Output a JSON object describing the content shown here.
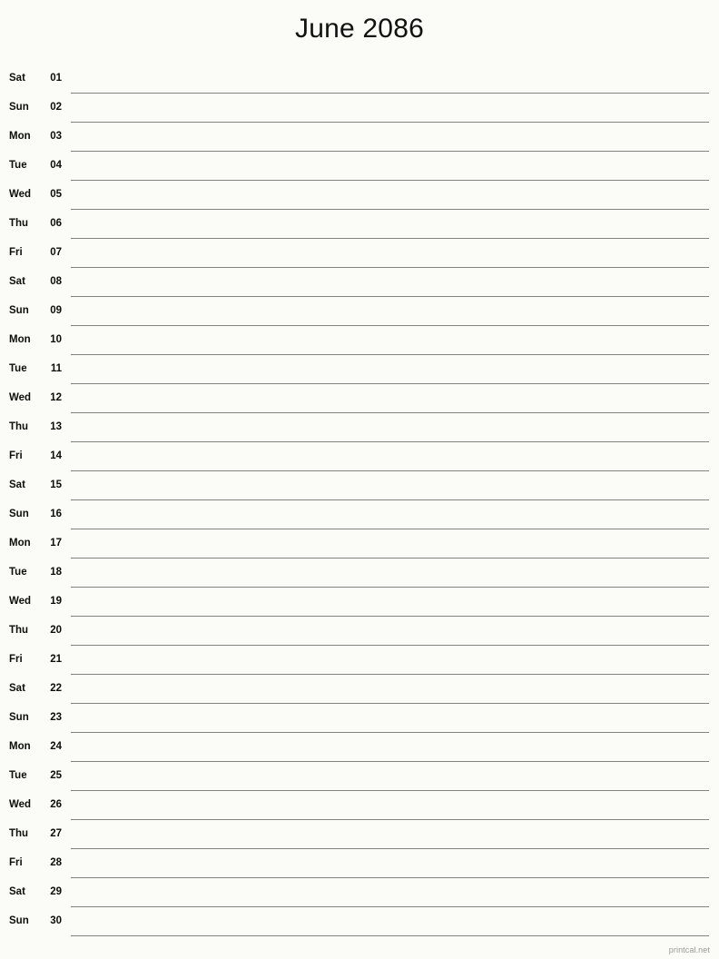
{
  "document": {
    "title": "June 2086",
    "month": "June",
    "year": "2086",
    "footer": "printcal.net",
    "line_color": "#83837b",
    "background_color": "#fbfbf7",
    "text_color": "#0d0d0d"
  },
  "days": [
    {
      "weekday": "Sat",
      "date": "01"
    },
    {
      "weekday": "Sun",
      "date": "02"
    },
    {
      "weekday": "Mon",
      "date": "03"
    },
    {
      "weekday": "Tue",
      "date": "04"
    },
    {
      "weekday": "Wed",
      "date": "05"
    },
    {
      "weekday": "Thu",
      "date": "06"
    },
    {
      "weekday": "Fri",
      "date": "07"
    },
    {
      "weekday": "Sat",
      "date": "08"
    },
    {
      "weekday": "Sun",
      "date": "09"
    },
    {
      "weekday": "Mon",
      "date": "10"
    },
    {
      "weekday": "Tue",
      "date": "11"
    },
    {
      "weekday": "Wed",
      "date": "12"
    },
    {
      "weekday": "Thu",
      "date": "13"
    },
    {
      "weekday": "Fri",
      "date": "14"
    },
    {
      "weekday": "Sat",
      "date": "15"
    },
    {
      "weekday": "Sun",
      "date": "16"
    },
    {
      "weekday": "Mon",
      "date": "17"
    },
    {
      "weekday": "Tue",
      "date": "18"
    },
    {
      "weekday": "Wed",
      "date": "19"
    },
    {
      "weekday": "Thu",
      "date": "20"
    },
    {
      "weekday": "Fri",
      "date": "21"
    },
    {
      "weekday": "Sat",
      "date": "22"
    },
    {
      "weekday": "Sun",
      "date": "23"
    },
    {
      "weekday": "Mon",
      "date": "24"
    },
    {
      "weekday": "Tue",
      "date": "25"
    },
    {
      "weekday": "Wed",
      "date": "26"
    },
    {
      "weekday": "Thu",
      "date": "27"
    },
    {
      "weekday": "Fri",
      "date": "28"
    },
    {
      "weekday": "Sat",
      "date": "29"
    },
    {
      "weekday": "Sun",
      "date": "30"
    }
  ]
}
